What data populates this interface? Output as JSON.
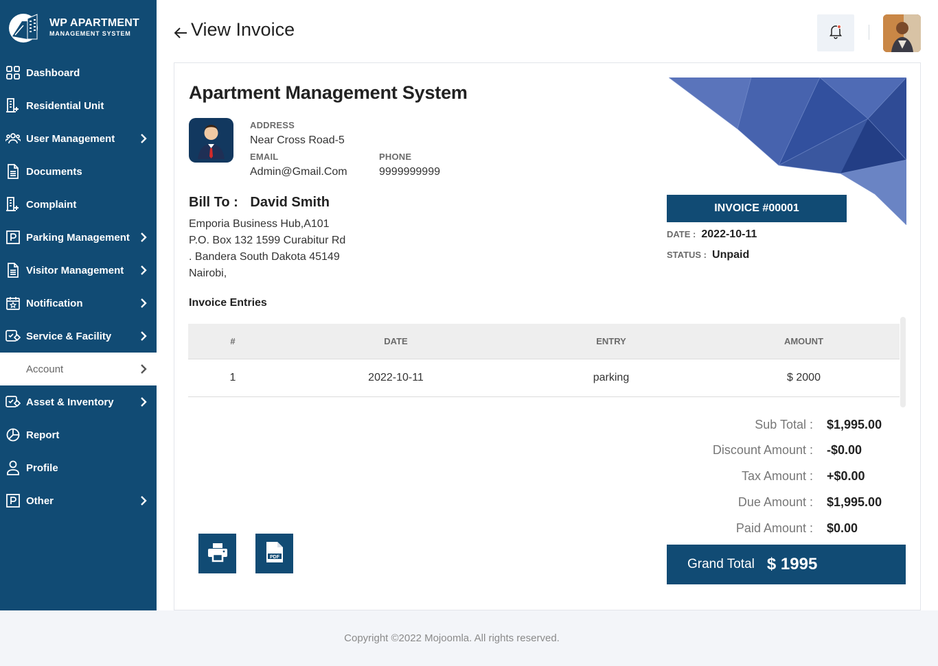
{
  "brand": {
    "title": "WP APARTMENT",
    "subtitle": "MANAGEMENT SYSTEM"
  },
  "sidebar": {
    "items": [
      {
        "label": "Dashboard",
        "icon": "grid-icon",
        "has_submenu": false
      },
      {
        "label": "Residential Unit",
        "icon": "building-icon",
        "has_submenu": false
      },
      {
        "label": "User Management",
        "icon": "users-icon",
        "has_submenu": true
      },
      {
        "label": "Documents",
        "icon": "document-icon",
        "has_submenu": false
      },
      {
        "label": "Complaint",
        "icon": "building-icon",
        "has_submenu": false
      },
      {
        "label": "Parking Management",
        "icon": "parking-icon",
        "has_submenu": true
      },
      {
        "label": "Visitor Management",
        "icon": "document-icon",
        "has_submenu": true
      },
      {
        "label": "Notification",
        "icon": "calendar-star-icon",
        "has_submenu": true
      },
      {
        "label": "Service & Facility",
        "icon": "service-icon",
        "has_submenu": true
      },
      {
        "label": "Account",
        "icon": "account-icon",
        "has_submenu": true,
        "active": true
      },
      {
        "label": "Asset & Inventory",
        "icon": "service-icon",
        "has_submenu": true
      },
      {
        "label": "Report",
        "icon": "pie-chart-icon",
        "has_submenu": false
      },
      {
        "label": "Profile",
        "icon": "user-icon",
        "has_submenu": false
      },
      {
        "label": "Other",
        "icon": "parking-icon",
        "has_submenu": true
      }
    ]
  },
  "header": {
    "title": "View Invoice"
  },
  "invoice": {
    "company_name": "Apartment Management System",
    "address_label": "ADDRESS",
    "address": "Near Cross Road-5",
    "email_label": "EMAIL",
    "email": "Admin@Gmail.Com",
    "phone_label": "PHONE",
    "phone": "9999999999",
    "bill_to_label": "Bill To :",
    "bill_to_name": "David Smith",
    "bill_to_address": [
      "Emporia Business Hub,A101",
      "P.O. Box 132 1599 Curabitur Rd",
      ". Bandera South Dakota 45149",
      "Nairobi,"
    ],
    "number": "INVOICE #00001",
    "date_label": "DATE :",
    "date": "2022-10-11",
    "status_label": "STATUS :",
    "status": "Unpaid",
    "entries_title": "Invoice Entries",
    "columns": [
      "#",
      "DATE",
      "ENTRY",
      "AMOUNT"
    ],
    "rows": [
      [
        "1",
        "2022-10-11",
        "parking",
        "$ 2000"
      ]
    ],
    "totals": [
      {
        "label": "Sub Total :",
        "value": "$1,995.00"
      },
      {
        "label": "Discount Amount :",
        "value": "-$0.00"
      },
      {
        "label": "Tax Amount :",
        "value": "+$0.00"
      },
      {
        "label": "Due Amount :",
        "value": "$1,995.00"
      },
      {
        "label": "Paid Amount :",
        "value": "$0.00"
      }
    ],
    "grand_total_label": "Grand Total",
    "grand_total_value": "$ 1995"
  },
  "footer": {
    "copyright": "Copyright ©2022 Mojoomla. All rights reserved."
  },
  "colors": {
    "primary": "#114b74",
    "decor": "#3d5aa8"
  }
}
